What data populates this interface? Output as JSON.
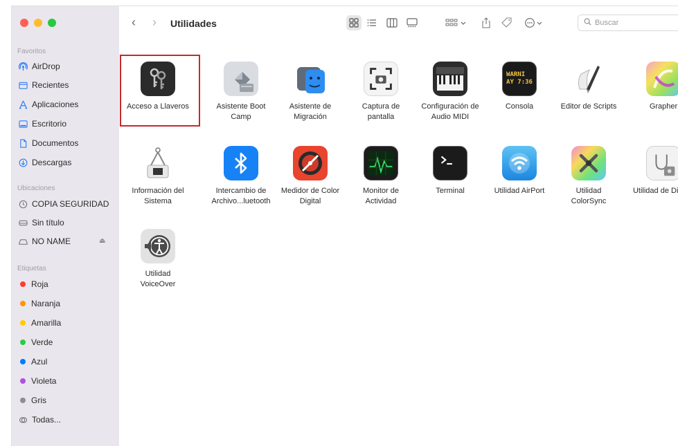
{
  "window": {
    "title": "Utilidades"
  },
  "sidebar": {
    "favorites_title": "Favoritos",
    "favorites": [
      {
        "label": "AirDrop",
        "icon": "airdrop-icon"
      },
      {
        "label": "Recientes",
        "icon": "recents-icon"
      },
      {
        "label": "Aplicaciones",
        "icon": "applications-icon"
      },
      {
        "label": "Escritorio",
        "icon": "desktop-icon"
      },
      {
        "label": "Documentos",
        "icon": "documents-icon"
      },
      {
        "label": "Descargas",
        "icon": "downloads-icon"
      }
    ],
    "locations_title": "Ubicaciones",
    "locations": [
      {
        "label": "COPIA SEGURIDAD",
        "icon": "time-machine-icon"
      },
      {
        "label": "Sin título",
        "icon": "disk-icon"
      },
      {
        "label": "NO NAME",
        "icon": "external-disk-icon"
      }
    ],
    "tags_title": "Etiquetas",
    "tags": [
      {
        "label": "Roja",
        "color": "#ff3b30"
      },
      {
        "label": "Naranja",
        "color": "#ff9500"
      },
      {
        "label": "Amarilla",
        "color": "#ffcc00"
      },
      {
        "label": "Verde",
        "color": "#28cd41"
      },
      {
        "label": "Azul",
        "color": "#007aff"
      },
      {
        "label": "Violeta",
        "color": "#af52de"
      },
      {
        "label": "Gris",
        "color": "#8e8e93"
      }
    ],
    "all_tags": "Todas..."
  },
  "toolbar": {
    "search_placeholder": "Buscar"
  },
  "apps": [
    {
      "line1": "Acceso a Llaveros",
      "line2": "",
      "icon": "keychain-icon",
      "selected": true
    },
    {
      "line1": "Asistente Boot",
      "line2": "Camp",
      "icon": "bootcamp-icon"
    },
    {
      "line1": "Asistente de",
      "line2": "Migración",
      "icon": "migration-icon"
    },
    {
      "line1": "Captura de",
      "line2": "pantalla",
      "icon": "screenshot-icon"
    },
    {
      "line1": "Configuración de",
      "line2": "Audio MIDI",
      "icon": "midi-icon"
    },
    {
      "line1": "Consola",
      "line2": "",
      "icon": "console-icon",
      "icon_text1": "WARNI",
      "icon_text2": "AY 7:36"
    },
    {
      "line1": "Editor de Scripts",
      "line2": "",
      "icon": "script-editor-icon"
    },
    {
      "line1": "Grapher",
      "line2": "",
      "icon": "grapher-icon"
    },
    {
      "line1": "Información del",
      "line2": "Sistema",
      "icon": "system-info-icon"
    },
    {
      "line1": "Intercambio de",
      "line2": "Archivo...luetooth",
      "icon": "bluetooth-icon"
    },
    {
      "line1": "Medidor de Color",
      "line2": "Digital",
      "icon": "color-meter-icon"
    },
    {
      "line1": "Monitor de",
      "line2": "Actividad",
      "icon": "activity-monitor-icon"
    },
    {
      "line1": "Terminal",
      "line2": "",
      "icon": "terminal-icon"
    },
    {
      "line1": "Utilidad AirPort",
      "line2": "",
      "icon": "airport-icon"
    },
    {
      "line1": "Utilidad",
      "line2": "ColorSync",
      "icon": "colorsync-icon"
    },
    {
      "line1": "Utilidad de Discos",
      "line2": "",
      "icon": "disk-utility-icon"
    },
    {
      "line1": "Utilidad",
      "line2": "VoiceOver",
      "icon": "voiceover-icon"
    }
  ]
}
